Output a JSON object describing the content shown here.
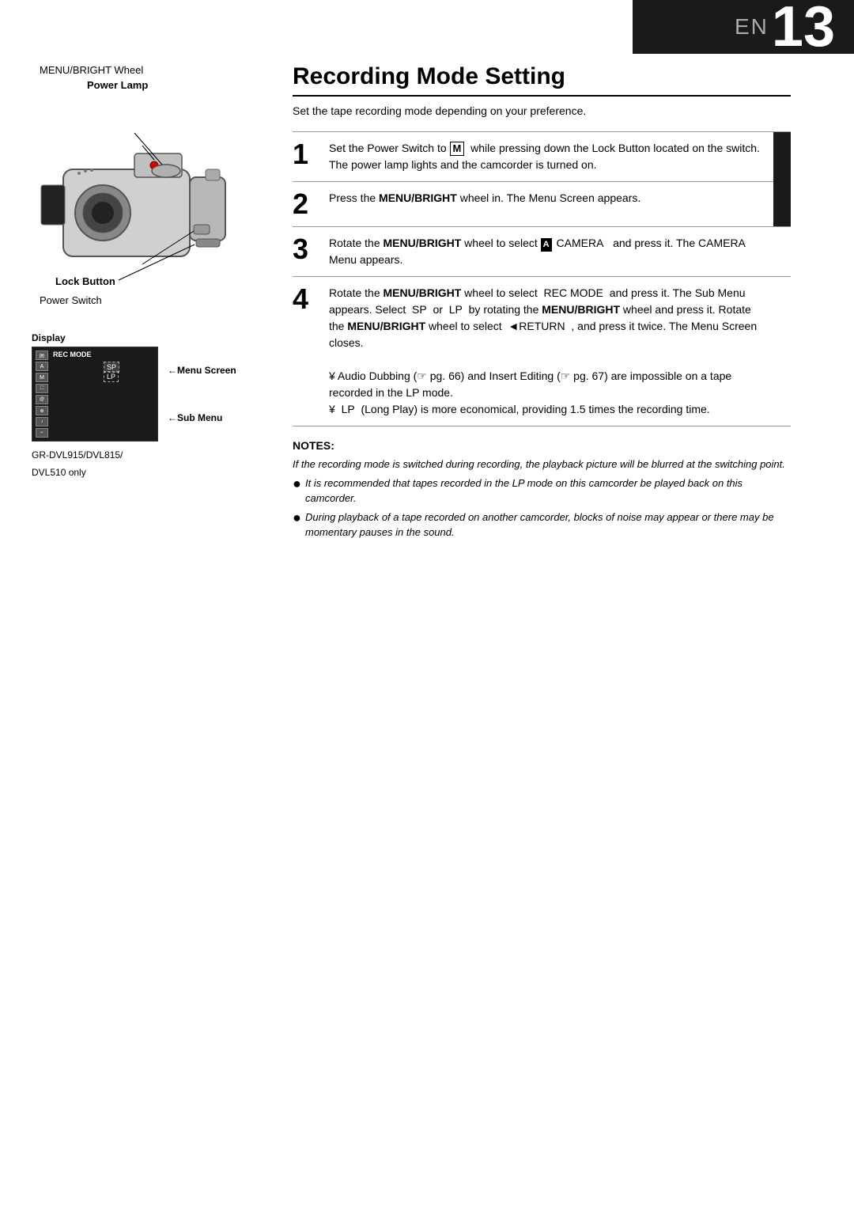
{
  "header": {
    "en_label": "EN",
    "page_number": "13"
  },
  "left_column": {
    "labels": {
      "menu_bright_wheel": "MENU/BRIGHT Wheel",
      "power_lamp": "Power Lamp",
      "lock_button": "Lock Button",
      "power_switch": "Power Switch",
      "display": "Display",
      "menu_screen": "Menu Screen",
      "sub_menu": "Sub Menu"
    },
    "screen": {
      "rec_mode": "REC MODE",
      "sp": "SP",
      "lp": "LP",
      "icons": [
        "囲",
        "A",
        "M",
        "淋",
        "@",
        "⊕",
        "♪",
        "⌐"
      ]
    },
    "model_label": "GR-DVL915/DVL815/",
    "model_label2": "DVL510 only"
  },
  "right_column": {
    "title": "Recording Mode Setting",
    "subtitle": "Set the tape recording mode depending on your preference.",
    "steps": [
      {
        "number": "1",
        "text_parts": [
          {
            "type": "text",
            "content": "Set the Power Switch to "
          },
          {
            "type": "icon",
            "content": "M"
          },
          {
            "type": "text",
            "content": "  while pressing down the Lock Button located on the switch. The power lamp lights and the camcorder is turned on."
          }
        ],
        "has_accent": true
      },
      {
        "number": "2",
        "text_parts": [
          {
            "type": "text",
            "content": "Press the "
          },
          {
            "type": "bold",
            "content": "MENU/BRIGHT"
          },
          {
            "type": "text",
            "content": " wheel in. The Menu Screen appears."
          }
        ],
        "has_accent": true
      },
      {
        "number": "3",
        "text_parts": [
          {
            "type": "text",
            "content": "Rotate the "
          },
          {
            "type": "bold",
            "content": "MENU/BRIGHT"
          },
          {
            "type": "text",
            "content": " wheel to select "
          },
          {
            "type": "cam_icon",
            "content": "A"
          },
          {
            "type": "text",
            "content": " CAMERA   and press it. The CAMERA Menu appears."
          }
        ],
        "has_accent": false
      },
      {
        "number": "4",
        "text_parts": [
          {
            "type": "text",
            "content": "Rotate the "
          },
          {
            "type": "bold",
            "content": "MENU/BRIGHT"
          },
          {
            "type": "text",
            "content": " wheel to select  REC MODE  and press it. The Sub Menu appears. Select  SP  or  LP  by rotating the "
          },
          {
            "type": "bold",
            "content": "MENU/BRIGHT"
          },
          {
            "type": "text",
            "content": " wheel and press it. Rotate the "
          },
          {
            "type": "bold",
            "content": "MENU/BRIGHT"
          },
          {
            "type": "text",
            "content": " wheel to select  ◄RETURN  , and press it twice. The Menu Screen closes."
          }
        ],
        "has_accent": false,
        "yen_notes": [
          "¥ Audio Dubbing (☞ pg. 66) and Insert Editing (☞ pg. 67) are impossible on a tape recorded in the LP mode.",
          "¥  LP  (Long Play) is more economical, providing 1.5 times the recording time."
        ]
      }
    ],
    "notes": {
      "title": "NOTES:",
      "bullets": [
        "If the recording mode is switched during recording, the playback picture will be blurred at the switching point.",
        "It is recommended that tapes recorded in the LP mode on this camcorder be played back on this camcorder.",
        "During playback of a tape recorded on another camcorder, blocks of noise may appear or there may be momentary pauses in the sound."
      ]
    }
  }
}
